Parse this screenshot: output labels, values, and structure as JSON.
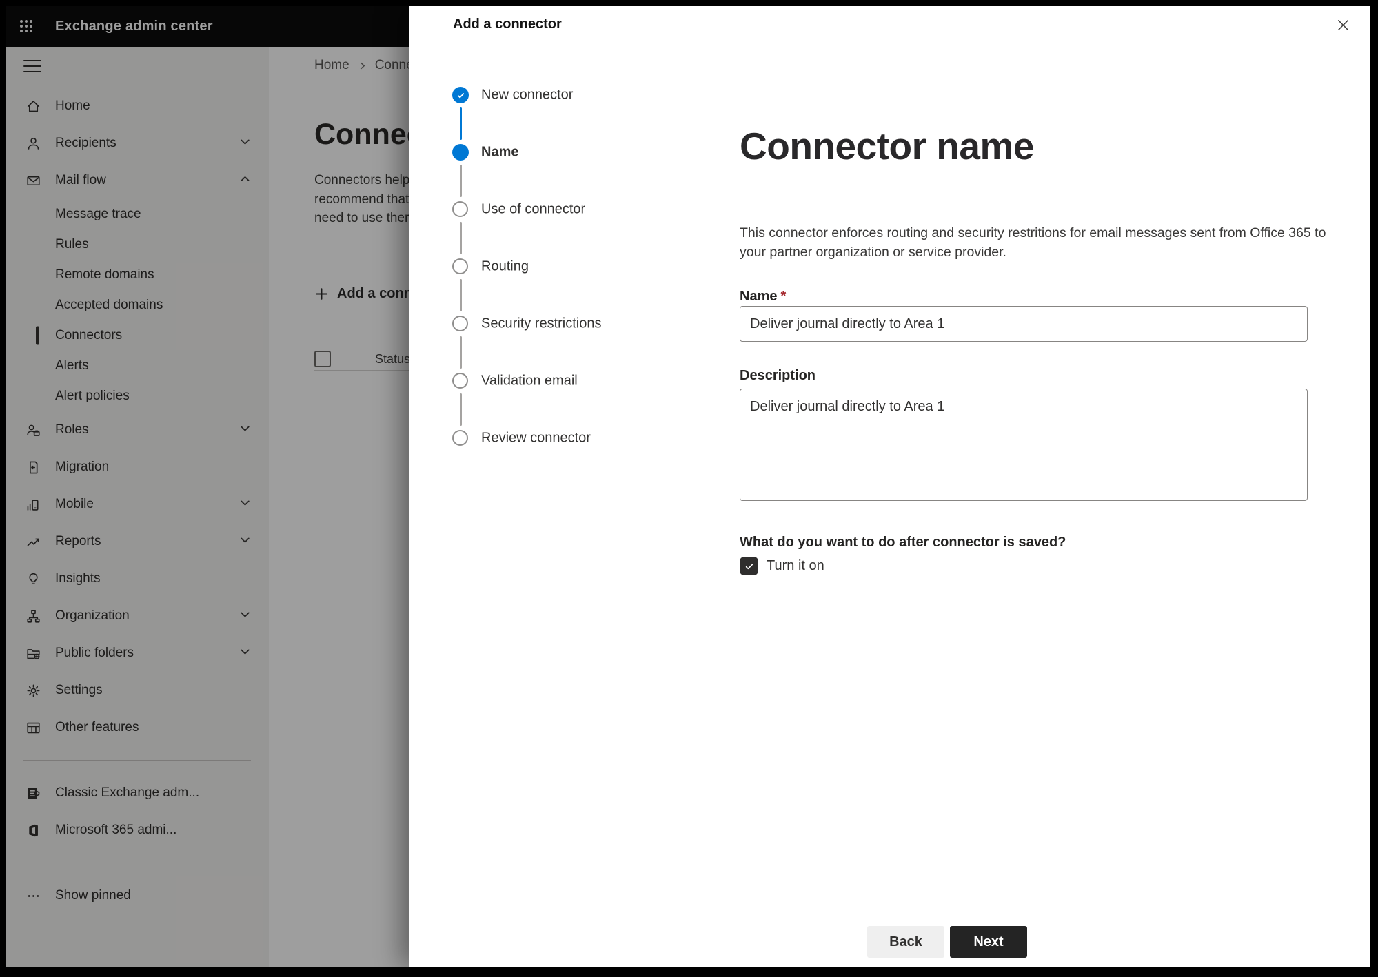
{
  "app": {
    "title": "Exchange admin center"
  },
  "sidebar": {
    "items": [
      {
        "label": "Home",
        "icon": "home-icon"
      },
      {
        "label": "Recipients",
        "icon": "person-icon",
        "chevron": "down"
      },
      {
        "label": "Mail flow",
        "icon": "mail-icon",
        "chevron": "up",
        "expanded": true
      },
      {
        "label": "Message trace",
        "sub": true
      },
      {
        "label": "Rules",
        "sub": true
      },
      {
        "label": "Remote domains",
        "sub": true
      },
      {
        "label": "Accepted domains",
        "sub": true
      },
      {
        "label": "Connectors",
        "sub": true,
        "selected": true
      },
      {
        "label": "Alerts",
        "sub": true
      },
      {
        "label": "Alert policies",
        "sub": true
      },
      {
        "label": "Roles",
        "icon": "roles-icon",
        "chevron": "down"
      },
      {
        "label": "Migration",
        "icon": "migration-icon"
      },
      {
        "label": "Mobile",
        "icon": "mobile-icon",
        "chevron": "down"
      },
      {
        "label": "Reports",
        "icon": "reports-icon",
        "chevron": "down"
      },
      {
        "label": "Insights",
        "icon": "lightbulb-icon"
      },
      {
        "label": "Organization",
        "icon": "org-chart-icon",
        "chevron": "down"
      },
      {
        "label": "Public folders",
        "icon": "folder-globe-icon",
        "chevron": "down"
      },
      {
        "label": "Settings",
        "icon": "gear-icon"
      },
      {
        "label": "Other features",
        "icon": "table-icon"
      },
      {
        "label": "Classic Exchange adm...",
        "icon": "exchange-logo-icon"
      },
      {
        "label": "Microsoft 365 admi...",
        "icon": "office-logo-icon"
      },
      {
        "label": "Show pinned",
        "icon": "ellipsis-icon"
      }
    ]
  },
  "page": {
    "breadcrumb": {
      "home": "Home",
      "current": "Conne"
    },
    "title": "Connec",
    "intro_lines": [
      "Connectors help",
      "recommend that",
      "need to use ther"
    ],
    "add_button": "Add a conn",
    "status_header": "Status"
  },
  "dialog": {
    "title": "Add a connector",
    "steps": [
      {
        "label": "New connector",
        "state": "done"
      },
      {
        "label": "Name",
        "state": "current"
      },
      {
        "label": "Use of connector",
        "state": "todo"
      },
      {
        "label": "Routing",
        "state": "todo"
      },
      {
        "label": "Security restrictions",
        "state": "todo"
      },
      {
        "label": "Validation email",
        "state": "todo"
      },
      {
        "label": "Review connector",
        "state": "todo"
      }
    ],
    "heading": "Connector name",
    "description": "This connector enforces routing and security restritions for email messages sent from Office 365 to your partner organization or service provider.",
    "name_label": "Name",
    "required_mark": "*",
    "name_value": "Deliver journal directly to Area 1",
    "description_label": "Description",
    "description_value": "Deliver journal directly to Area 1",
    "after_save_question": "What do you want to do after connector is saved?",
    "turn_on_label": "Turn it on",
    "turn_on_checked": true,
    "back_label": "Back",
    "next_label": "Next"
  },
  "colors": {
    "accent": "#0078d4",
    "topbar_bg": "#0c0c0c",
    "sidebar_bg": "#f3f2f1",
    "next_button_bg": "#242424",
    "back_button_bg": "#efefef",
    "required_mark": "#a4262c",
    "step_todo_border": "#8f8e8d",
    "overlay": "rgba(0,0,0,0.38)"
  }
}
